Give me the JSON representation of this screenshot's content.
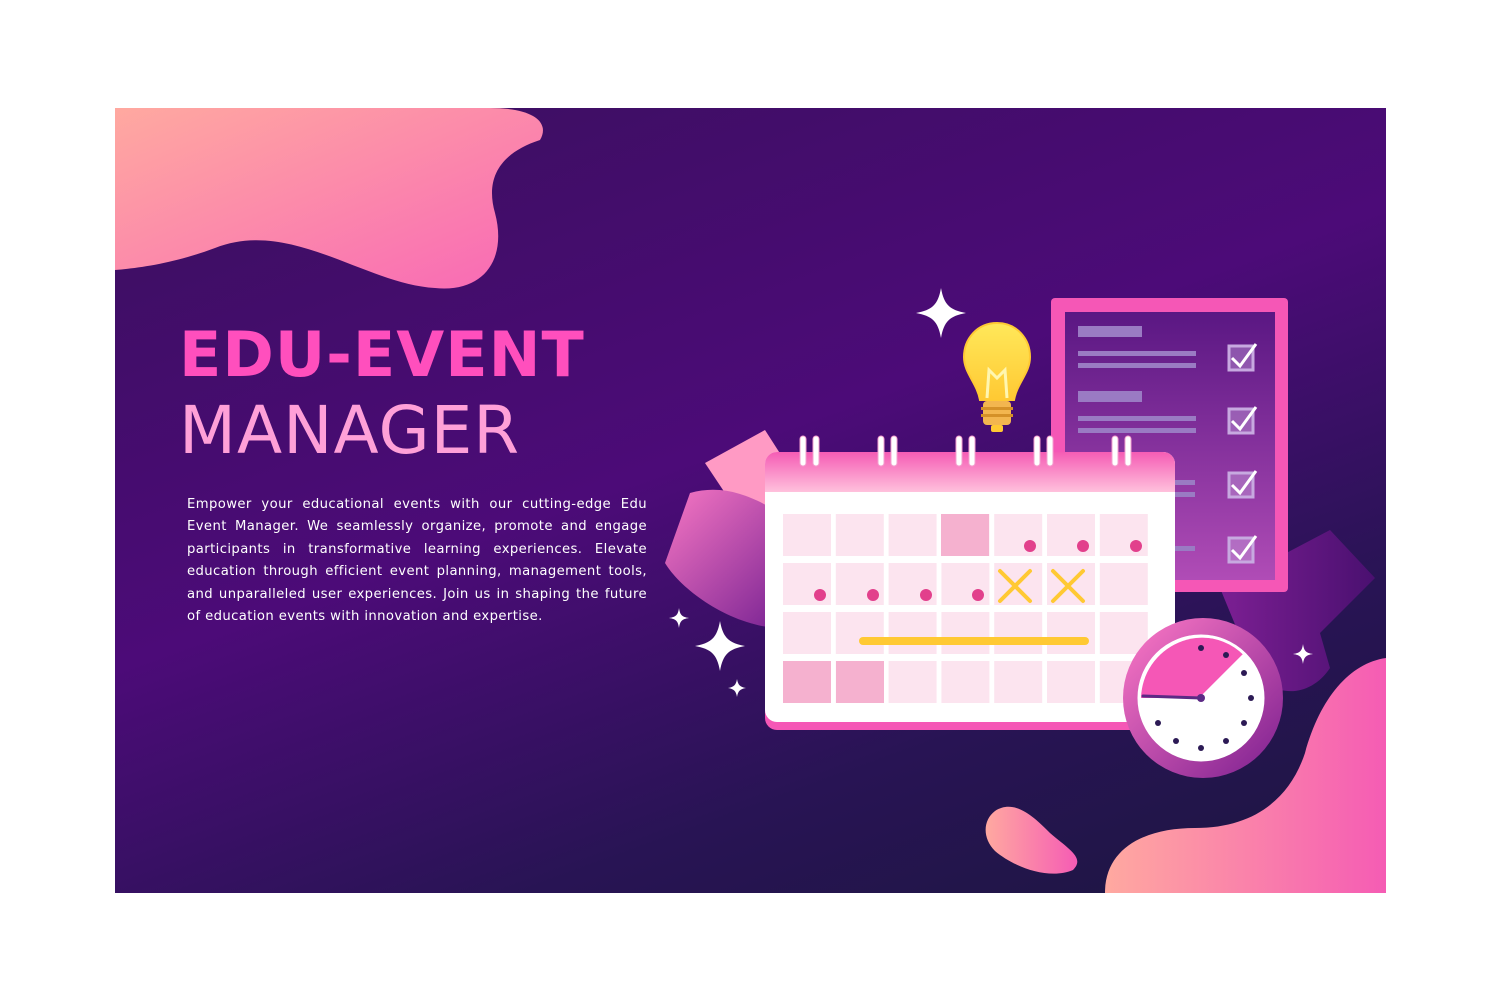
{
  "hero": {
    "title_line1": "EDU-EVENT",
    "title_line2": "MANAGER",
    "description": "Empower your educational events with our cutting-edge Edu Event Manager. We seamlessly organize, promote and engage participants in transformative learning experiences. Elevate education through efficient event planning, management tools, and unparalleled user experiences. Join us in shaping the future of education events with innovation and expertise."
  },
  "illustration": {
    "icons": [
      "calendar-icon",
      "checklist-icon",
      "lightbulb-icon",
      "clock-icon",
      "sparkle-icon"
    ],
    "checklist_checked_items": 4,
    "colors": {
      "background_dark": "#1c1640",
      "background_purple": "#4c0b78",
      "accent_pink": "#ff4fbd",
      "light_pink": "#ffa0d8",
      "peach": "#ffa9a0",
      "bulb_yellow": "#ffe85a",
      "cross_yellow": "#ffc933",
      "calendar_cell": "#fce4ef"
    }
  }
}
